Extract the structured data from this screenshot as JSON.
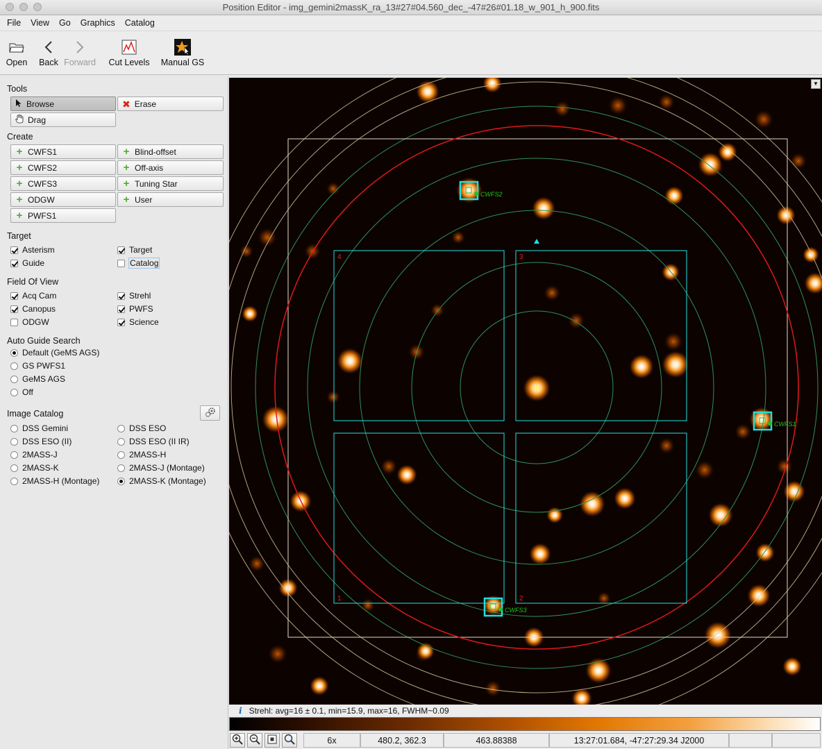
{
  "window": {
    "title": "Position Editor - img_gemini2massK_ra_13#27#04.560_dec_-47#26#01.18_w_901_h_900.fits"
  },
  "menu": [
    "File",
    "View",
    "Go",
    "Graphics",
    "Catalog"
  ],
  "toolbar": {
    "open": "Open",
    "back": "Back",
    "forward": "Forward",
    "cut_levels": "Cut Levels",
    "manual_gs": "Manual GS"
  },
  "tools": {
    "heading": "Tools",
    "browse": "Browse",
    "erase": "Erase",
    "drag": "Drag"
  },
  "create": {
    "heading": "Create",
    "buttons": [
      "CWFS1",
      "Blind-offset",
      "CWFS2",
      "Off-axis",
      "CWFS3",
      "Tuning Star",
      "ODGW",
      "User",
      "PWFS1"
    ]
  },
  "target": {
    "heading": "Target",
    "options": [
      {
        "label": "Asterism",
        "checked": true
      },
      {
        "label": "Target",
        "checked": true
      },
      {
        "label": "Guide",
        "checked": true
      },
      {
        "label": "Catalog",
        "checked": false
      }
    ]
  },
  "fov": {
    "heading": "Field Of View",
    "options": [
      {
        "label": "Acq Cam",
        "checked": true
      },
      {
        "label": "Strehl",
        "checked": true
      },
      {
        "label": "Canopus",
        "checked": true
      },
      {
        "label": "PWFS",
        "checked": true
      },
      {
        "label": "ODGW",
        "checked": false
      },
      {
        "label": "Science",
        "checked": true
      }
    ]
  },
  "ags": {
    "heading": "Auto Guide Search",
    "options": [
      "Default (GeMS AGS)",
      "GS PWFS1",
      "GeMS AGS",
      "Off"
    ],
    "selected": "Default (GeMS AGS)"
  },
  "catalog": {
    "heading": "Image Catalog",
    "options": [
      "DSS Gemini",
      "DSS ESO",
      "DSS ESO (II)",
      "DSS ESO (II IR)",
      "2MASS-J",
      "2MASS-H",
      "2MASS-K",
      "2MASS-J (Montage)",
      "2MASS-H (Montage)",
      "2MASS-K (Montage)"
    ],
    "selected": "2MASS-K (Montage)"
  },
  "overlay": {
    "cwfs_labels": [
      "CWFS2",
      "CWFS1",
      "CWFS3"
    ],
    "quadrant_numbers": [
      "4",
      "3",
      "1",
      "2"
    ]
  },
  "status": {
    "icon": "i",
    "text": "Strehl: avg=16 ± 0.1,  min=15.9,  max=16,  FWHM~0.09"
  },
  "readout": {
    "zoom": "6x",
    "pixel": "480.2, 362.3",
    "value": "463.88388",
    "coords": "13:27:01.684, -47:27:29.34 J2000"
  },
  "colors": {
    "cyan": "#20e0e0",
    "red": "#e01818",
    "green": "#22c022",
    "ring": "#2f8f5a"
  }
}
